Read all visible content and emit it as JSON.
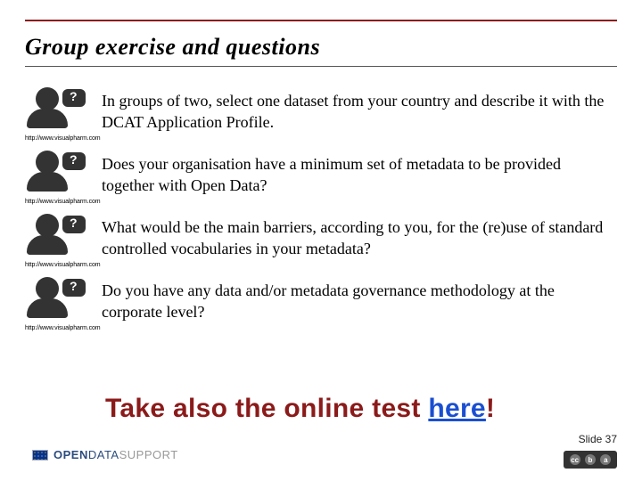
{
  "title": "Group exercise and questions",
  "attribution": "http://www.visualpharm.com",
  "items": [
    {
      "text": "In groups of two, select one dataset from your country and describe it with the DCAT Application Profile."
    },
    {
      "text": "Does your organisation have a minimum set of metadata to be provided together with Open Data?"
    },
    {
      "text": "What would be the main barriers, according to you, for the (re)use of standard controlled vocabularies in your metadata?"
    },
    {
      "text": "Do you have any data and/or metadata governance methodology at the corporate level?"
    }
  ],
  "cta": {
    "prefix": "Take also the online test ",
    "link_text": "here",
    "suffix": "!"
  },
  "footer": {
    "logo_open": "OPEN",
    "logo_data": "DATA",
    "logo_support": "SUPPORT",
    "slide_label": "Slide 37"
  }
}
